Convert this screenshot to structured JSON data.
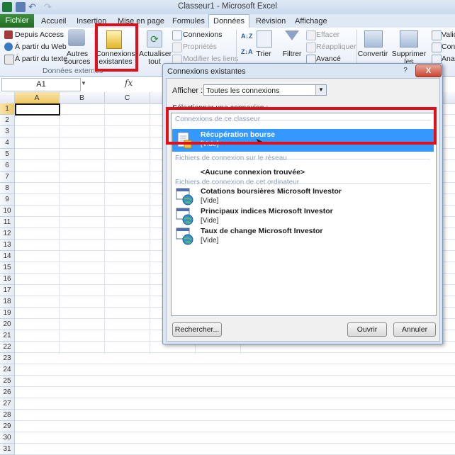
{
  "window": {
    "title": "Classeur1 - Microsoft Excel"
  },
  "tabs": [
    "Fichier",
    "Accueil",
    "Insertion",
    "Mise en page",
    "Formules",
    "Données",
    "Révision",
    "Affichage"
  ],
  "active_tab": "Données",
  "ribbon": {
    "external_data": {
      "depuis_access": "Depuis Access",
      "web": "À partir du Web",
      "texte": "À partir du texte",
      "autres_sources_1": "Autres",
      "autres_sources_2": "sources",
      "group_label": "Données externes"
    },
    "connexions_existantes_1": "Connexions",
    "connexions_existantes_2": "existantes",
    "actualiser_1": "Actualiser",
    "actualiser_2": "tout",
    "connexions": "Connexions",
    "proprietes": "Propriétés",
    "modifier_liens": "Modifier les liens",
    "trier": "Trier",
    "filtrer": "Filtrer",
    "effacer": "Effacer",
    "reappliquer": "Réappliquer",
    "avance": "Avancé",
    "convertir": "Convertir",
    "supprimer_1": "Supprimer",
    "supprimer_2": "les doublons",
    "valid": "Valid",
    "consol": "Conso",
    "analyse": "Analy"
  },
  "formula_bar": {
    "name_box": "A1",
    "fx": "fx"
  },
  "grid": {
    "columns": [
      "A",
      "B",
      "C"
    ],
    "rows": [
      "1",
      "2",
      "3",
      "4",
      "5",
      "6",
      "7",
      "8",
      "9",
      "10",
      "11",
      "12",
      "13",
      "14",
      "15",
      "16",
      "17",
      "18",
      "19",
      "20",
      "21",
      "22",
      "23",
      "24",
      "25",
      "26",
      "27",
      "28",
      "29",
      "30",
      "31"
    ]
  },
  "dialog": {
    "title": "Connexions existantes",
    "help": "?",
    "close": "X",
    "afficher_label": "Afficher :",
    "afficher_value": "Toutes les connexions",
    "select_label": "Sélectionner une connexion :",
    "sections": {
      "workbook": "Connexions de ce classeur",
      "network": "Fichiers de connexion sur le réseau",
      "computer": "Fichiers de connexion de cet ordinateur"
    },
    "items": [
      {
        "title": "Récupération bourse",
        "sub": "[Vide]"
      },
      {
        "title": "<Aucune connexion trouvée>",
        "sub": ""
      },
      {
        "title": "Cotations boursières Microsoft Investor",
        "sub": "[Vide]"
      },
      {
        "title": "Principaux indices Microsoft Investor",
        "sub": "[Vide]"
      },
      {
        "title": "Taux de change Microsoft Investor",
        "sub": "[Vide]"
      }
    ],
    "buttons": {
      "rechercher": "Rechercher...",
      "ouvrir": "Ouvrir",
      "annuler": "Annuler"
    }
  },
  "colors": {
    "selection": "#3399ff",
    "highlight": "#e0101b",
    "fichier_tab": "#2f7d2f"
  }
}
